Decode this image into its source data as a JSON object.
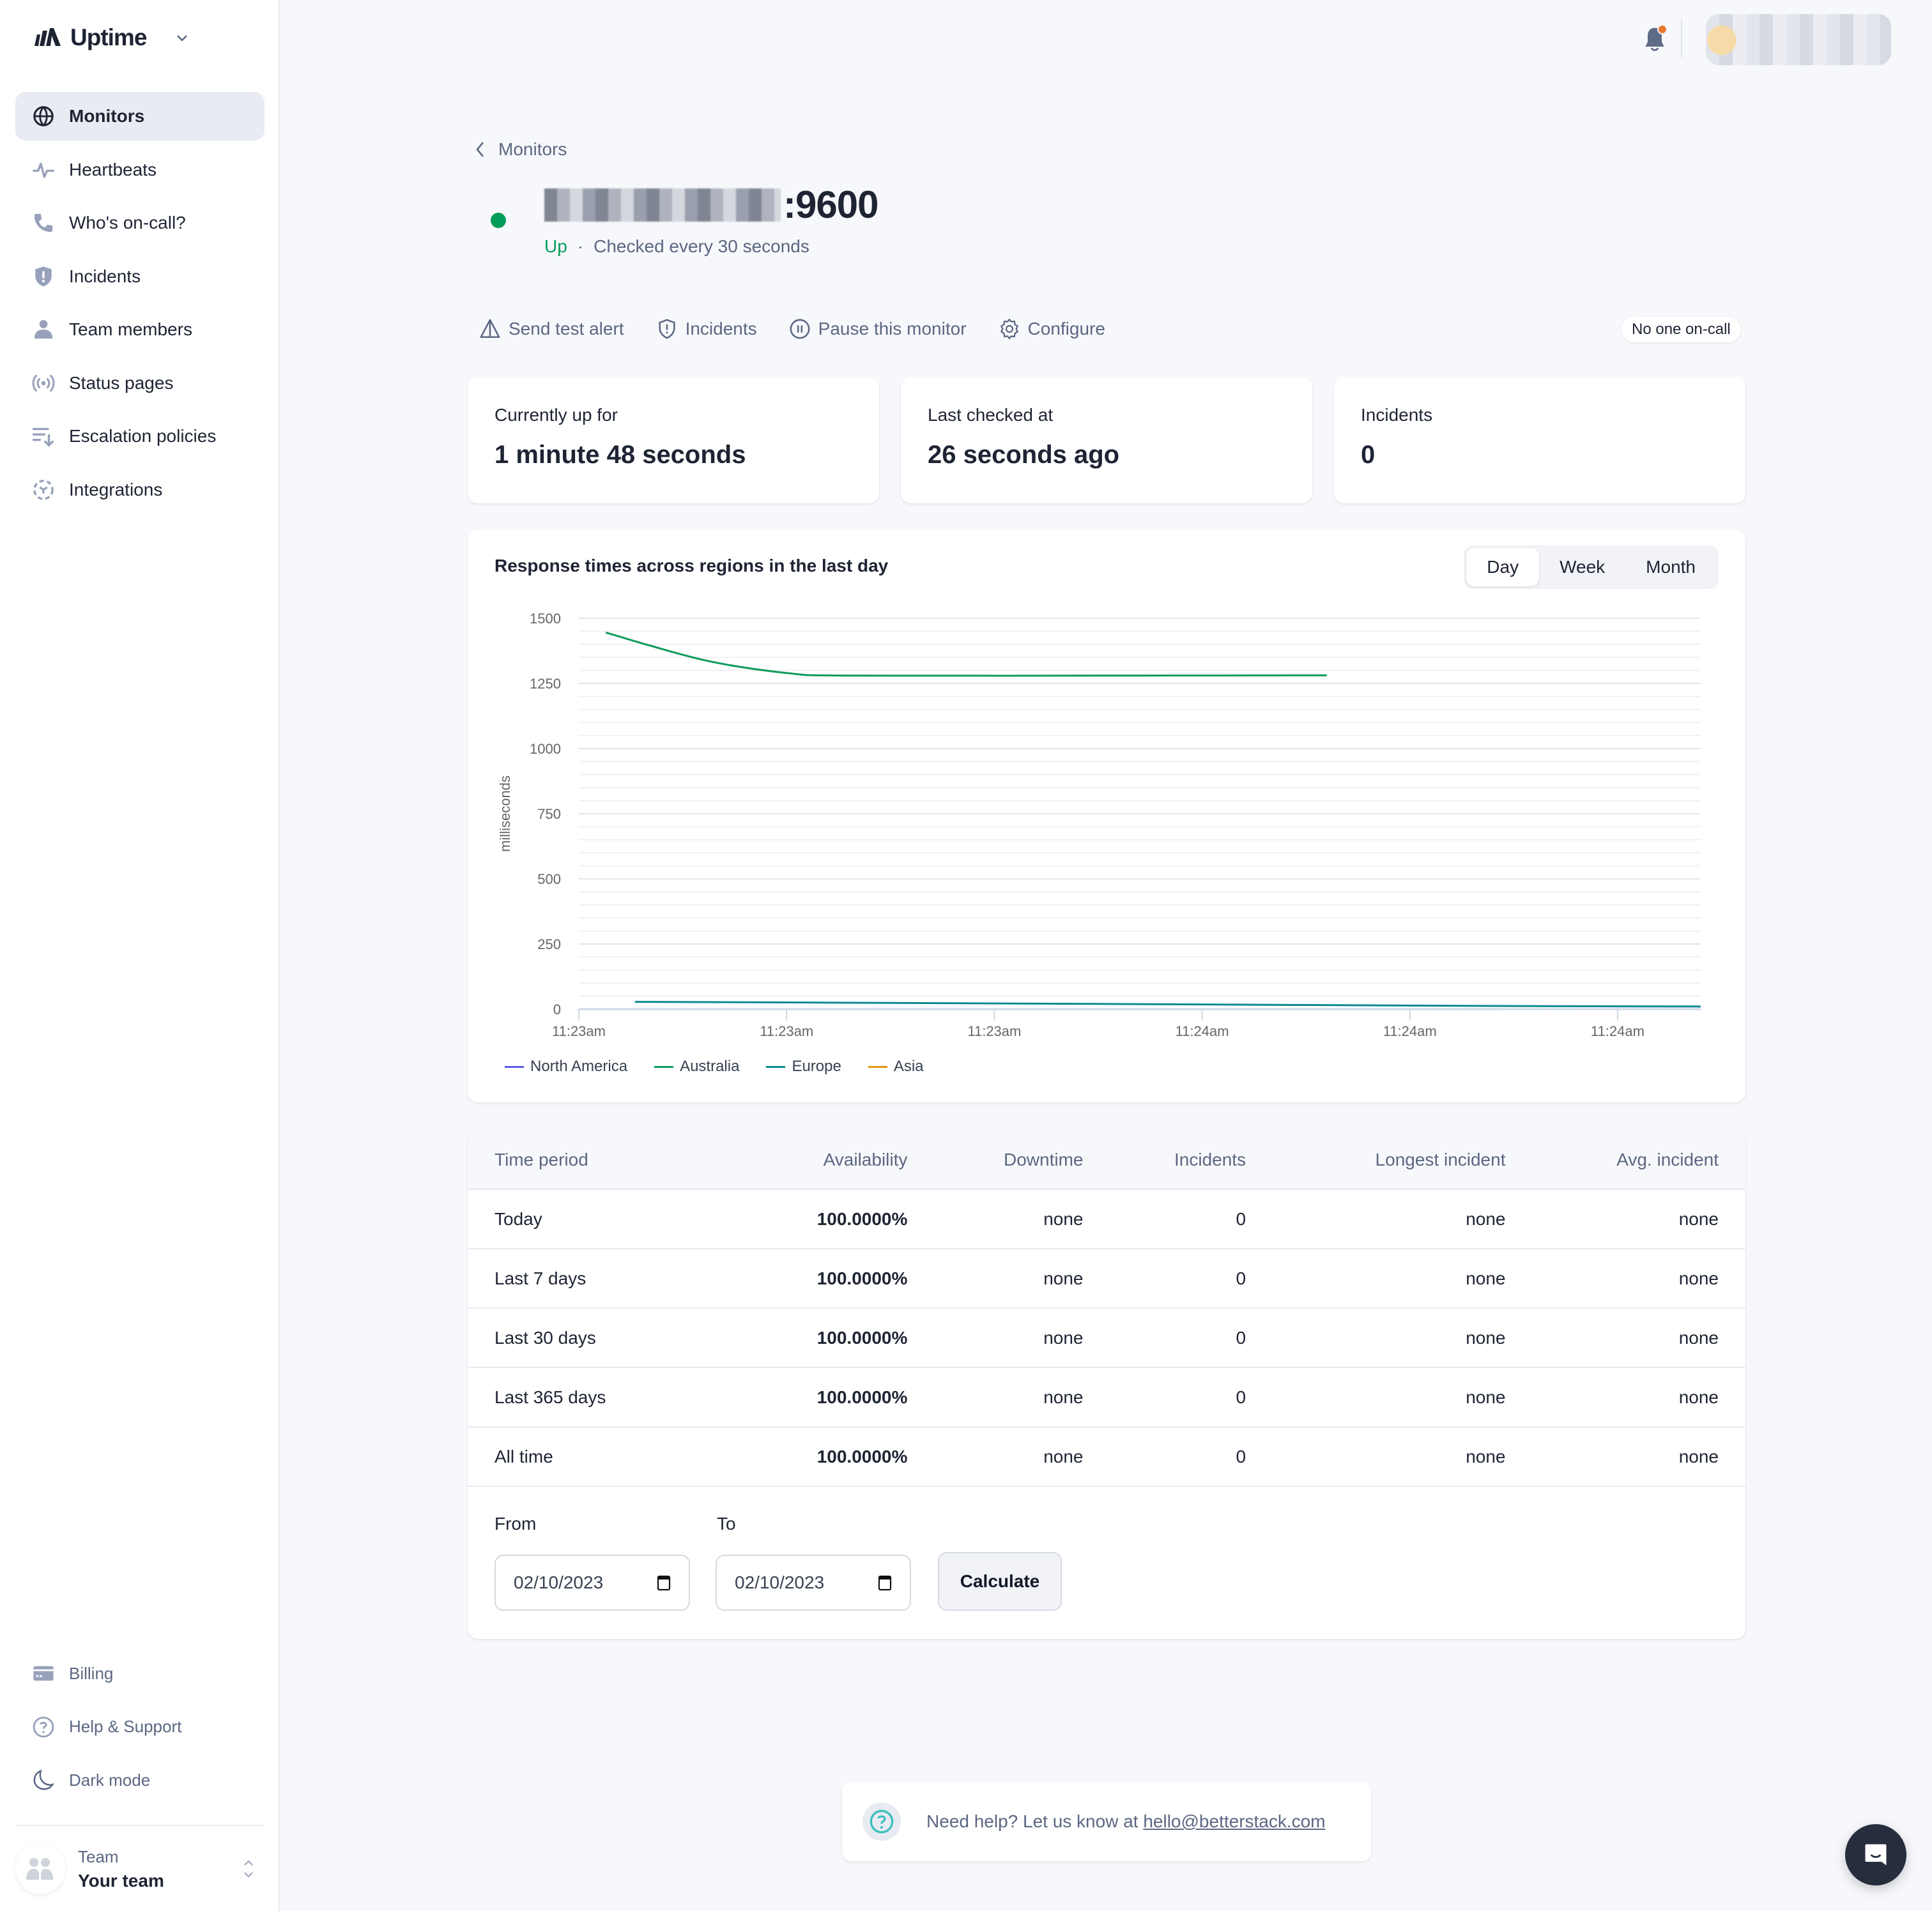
{
  "brand": {
    "name": "Uptime"
  },
  "sidebar": {
    "items": [
      {
        "label": "Monitors",
        "icon": "globe-icon",
        "active": true
      },
      {
        "label": "Heartbeats",
        "icon": "pulse-icon"
      },
      {
        "label": "Who's on-call?",
        "icon": "phone-icon"
      },
      {
        "label": "Incidents",
        "icon": "shield-alert-icon"
      },
      {
        "label": "Team members",
        "icon": "user-icon"
      },
      {
        "label": "Status pages",
        "icon": "broadcast-icon"
      },
      {
        "label": "Escalation policies",
        "icon": "sort-down-icon"
      },
      {
        "label": "Integrations",
        "icon": "puzzle-icon"
      }
    ],
    "bottom_items": [
      {
        "label": "Billing",
        "icon": "credit-card-icon"
      },
      {
        "label": "Help & Support",
        "icon": "help-circle-icon"
      },
      {
        "label": "Dark mode",
        "icon": "moon-icon"
      }
    ],
    "team": {
      "label": "Team",
      "name": "Your team"
    }
  },
  "topbar": {
    "notification_badge": true
  },
  "breadcrumb": {
    "label": "Monitors"
  },
  "monitor": {
    "title_suffix": ":9600",
    "status": "Up",
    "separator": "·",
    "check_interval": "Checked every 30 seconds",
    "status_color": "#049c5a"
  },
  "actions": [
    {
      "label": "Send test alert",
      "icon": "alert-triangle-icon"
    },
    {
      "label": "Incidents",
      "icon": "shield-alert-icon"
    },
    {
      "label": "Pause this monitor",
      "icon": "pause-circle-icon"
    },
    {
      "label": "Configure",
      "icon": "gear-icon"
    }
  ],
  "oncall_badge": "No one on-call",
  "cards": [
    {
      "label": "Currently up for",
      "value": "1 minute 48 seconds"
    },
    {
      "label": "Last checked at",
      "value": "26 seconds ago"
    },
    {
      "label": "Incidents",
      "value": "0"
    }
  ],
  "chart_section": {
    "title": "Response times across regions in the last day",
    "ranges": [
      "Day",
      "Week",
      "Month"
    ],
    "active_range": "Day"
  },
  "chart_data": {
    "type": "line",
    "title": "Response times across regions in the last day",
    "xlabel": "",
    "ylabel": "milliseconds",
    "ylim": [
      0,
      1500
    ],
    "yticks": [
      0,
      250,
      500,
      750,
      1000,
      1250,
      1500
    ],
    "minor_grid_step": 50,
    "grid": true,
    "xticks": [
      "11:23am",
      "11:23am",
      "11:23am",
      "11:24am",
      "11:24am",
      "11:24am"
    ],
    "x_range": [
      0,
      5.4
    ],
    "legend_position": "bottom-left",
    "series": [
      {
        "name": "North America",
        "color": "#5b5ce6",
        "points": []
      },
      {
        "name": "Australia",
        "color": "#0d9b5c",
        "points": [
          [
            0.13,
            1445
          ],
          [
            0.6,
            1340
          ],
          [
            1.0,
            1290
          ],
          [
            1.3,
            1280
          ],
          [
            2.5,
            1280
          ],
          [
            3.6,
            1281
          ]
        ]
      },
      {
        "name": "Europe",
        "color": "#0e8a8f",
        "points": [
          [
            0.27,
            28
          ],
          [
            1.5,
            24
          ],
          [
            3.0,
            18
          ],
          [
            4.5,
            12
          ],
          [
            5.4,
            10
          ]
        ]
      },
      {
        "name": "Asia",
        "color": "#e2960f",
        "points": []
      }
    ]
  },
  "availability_table": {
    "headers": [
      "Time period",
      "Availability",
      "Downtime",
      "Incidents",
      "Longest incident",
      "Avg. incident"
    ],
    "rows": [
      [
        "Today",
        "100.0000%",
        "none",
        "0",
        "none",
        "none"
      ],
      [
        "Last 7 days",
        "100.0000%",
        "none",
        "0",
        "none",
        "none"
      ],
      [
        "Last 30 days",
        "100.0000%",
        "none",
        "0",
        "none",
        "none"
      ],
      [
        "Last 365 days",
        "100.0000%",
        "none",
        "0",
        "none",
        "none"
      ],
      [
        "All time",
        "100.0000%",
        "none",
        "0",
        "none",
        "none"
      ]
    ]
  },
  "date_range": {
    "from_label": "From",
    "to_label": "To",
    "from_value": "02/10/2023",
    "to_value": "02/10/2023",
    "calculate_label": "Calculate"
  },
  "help": {
    "text": "Need help? Let us know at ",
    "email": "hello@betterstack.com"
  }
}
